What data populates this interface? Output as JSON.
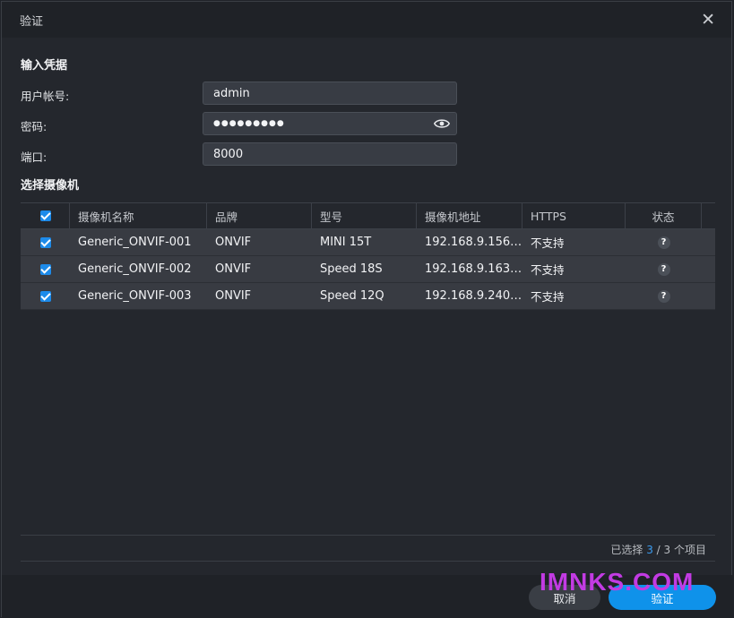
{
  "dialog": {
    "title": "验证",
    "close_icon": "close-icon"
  },
  "credentials": {
    "section_title": "输入凭据",
    "username_label": "用户帐号:",
    "username_value": "admin",
    "password_label": "密码:",
    "password_value": "●●●●●●●●●",
    "port_label": "端口:",
    "port_value": "8000"
  },
  "cameras": {
    "section_title": "选择摄像机",
    "columns": [
      "摄像机名称",
      "品牌",
      "型号",
      "摄像机地址",
      "HTTPS",
      "状态"
    ],
    "rows": [
      {
        "name": "Generic_ONVIF-001",
        "brand": "ONVIF",
        "model": "MINI 15T",
        "address": "192.168.9.156…",
        "https": "不支持",
        "status": "?",
        "checked": true
      },
      {
        "name": "Generic_ONVIF-002",
        "brand": "ONVIF",
        "model": "Speed 18S",
        "address": "192.168.9.163…",
        "https": "不支持",
        "status": "?",
        "checked": true
      },
      {
        "name": "Generic_ONVIF-003",
        "brand": "ONVIF",
        "model": "Speed 12Q",
        "address": "192.168.9.240…",
        "https": "不支持",
        "status": "?",
        "checked": true
      }
    ]
  },
  "selection": {
    "prefix": "已选择",
    "selected": "3",
    "separator": "/",
    "total": "3 个项目"
  },
  "buttons": {
    "cancel": "取消",
    "verify": "验证"
  },
  "watermark": "IMNKS.COM",
  "colors": {
    "accent": "#0f92ea",
    "checkbox": "#1d8bea"
  }
}
